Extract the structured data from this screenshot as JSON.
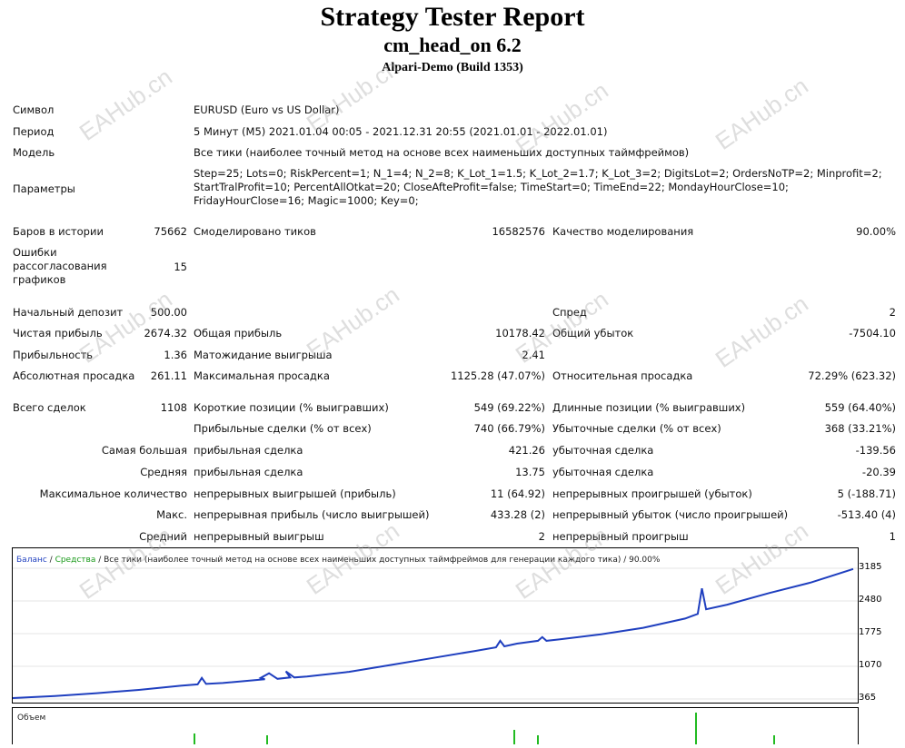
{
  "header": {
    "title": "Strategy Tester Report",
    "expert": "cm_head_on 6.2",
    "server": "Alpari-Demo (Build 1353)"
  },
  "info": {
    "symbol_label": "Символ",
    "symbol_value": "EURUSD (Euro vs US Dollar)",
    "period_label": "Период",
    "period_value": "5 Минут (M5) 2021.01.04 00:05 - 2021.12.31 20:55 (2021.01.01 - 2022.01.01)",
    "model_label": "Модель",
    "model_value": "Все тики (наиболее точный метод на основе всех наименьших доступных таймфреймов)",
    "params_label": "Параметры",
    "params_value": "Step=25; Lots=0; RiskPercent=1; N_1=4; N_2=8; K_Lot_1=1.5; K_Lot_2=1.7; K_Lot_3=2; DigitsLot=2; OrdersNoTP=2; Minprofit=2; StartTralProfit=10; PercentAllOtkat=20; CloseAfteProfit=false; TimeStart=0; TimeEnd=22; MondayHourClose=10; FridayHourClose=16; Magic=1000; Key=0;"
  },
  "stats": {
    "bars_label": "Баров в истории",
    "bars_value": "75662",
    "ticks_label": "Смоделировано тиков",
    "ticks_value": "16582576",
    "quality_label": "Качество моделирования",
    "quality_value": "90.00%",
    "mismatch_label": "Ошибки рассогласования графиков",
    "mismatch_value": "15",
    "deposit_label": "Начальный депозит",
    "deposit_value": "500.00",
    "spread_label": "Спред",
    "spread_value": "2",
    "net_label": "Чистая прибыль",
    "net_value": "2674.32",
    "gross_profit_label": "Общая прибыль",
    "gross_profit_value": "10178.42",
    "gross_loss_label": "Общий убыток",
    "gross_loss_value": "-7504.10",
    "pf_label": "Прибыльность",
    "pf_value": "1.36",
    "payoff_label": "Матожидание выигрыша",
    "payoff_value": "2.41",
    "abs_dd_label": "Абсолютная просадка",
    "abs_dd_value": "261.11",
    "max_dd_label": "Максимальная просадка",
    "max_dd_value": "1125.28 (47.07%)",
    "rel_dd_label": "Относительная просадка",
    "rel_dd_value": "72.29% (623.32)",
    "trades_label": "Всего сделок",
    "trades_value": "1108",
    "short_label": "Короткие позиции (% выигравших)",
    "short_value": "549 (69.22%)",
    "long_label": "Длинные позиции (% выигравших)",
    "long_value": "559 (64.40%)",
    "profit_trades_label": "Прибыльные сделки (% от всех)",
    "profit_trades_value": "740 (66.79%)",
    "loss_trades_label": "Убыточные сделки (% от всех)",
    "loss_trades_value": "368 (33.21%)",
    "largest_label": "Самая большая",
    "largest_profit_label": "прибыльная сделка",
    "largest_profit_value": "421.26",
    "largest_loss_label": "убыточная сделка",
    "largest_loss_value": "-139.56",
    "average_label": "Средняя",
    "average_profit_label": "прибыльная сделка",
    "average_profit_value": "13.75",
    "average_loss_label": "убыточная сделка",
    "average_loss_value": "-20.39",
    "maxcount_label": "Максимальное количество",
    "maxcount_wins_label": "непрерывных выигрышей (прибыль)",
    "maxcount_wins_value": "11 (64.92)",
    "maxcount_losses_label": "непрерывных проигрышей (убыток)",
    "maxcount_losses_value": "5 (-188.71)",
    "maxprofit_label": "Макс.",
    "maxprofit_wins_label": "непрерывная прибыль (число выигрышей)",
    "maxprofit_wins_value": "433.28 (2)",
    "maxprofit_losses_label": "непрерывный убыток (число проигрышей)",
    "maxprofit_losses_value": "-513.40 (4)",
    "avgcons_label": "Средний",
    "avgcons_wins_label": "непрерывный выигрыш",
    "avgcons_wins_value": "2",
    "avgcons_losses_label": "непрерывный проигрыш",
    "avgcons_losses_value": "1"
  },
  "chart_legend": {
    "balance": "Баланс",
    "sep": " / ",
    "equity": "Средства",
    "rest": " / Все тики (наиболее точный метод на основе всех наименьших доступных таймфреймов для генерации каждого тика) / 90.00%"
  },
  "volume_label": "Объем",
  "watermark": "EAHub.cn",
  "colors": {
    "balance": "#1f3fbf",
    "equity": "#1a9a1a",
    "volume": "#22bb22"
  },
  "chart_data": {
    "type": "line",
    "title": "",
    "xlabel": "",
    "ylabel": "",
    "yticks": [
      "3185",
      "2480",
      "1775",
      "1070",
      "365"
    ],
    "ylim": [
      365,
      3185
    ],
    "series": [
      {
        "name": "Баланс",
        "x": [
          0,
          5,
          10,
          15,
          20,
          22,
          22.5,
          23,
          25,
          30,
          29.5,
          30.5,
          31.5,
          33,
          32.5,
          33.5,
          35,
          40,
          45,
          50,
          55,
          57.5,
          58,
          58.5,
          60,
          62.5,
          63,
          63.5,
          65,
          70,
          75,
          80,
          81.5,
          82,
          82.5,
          85,
          90,
          95,
          100
        ],
        "y": [
          385,
          430,
          490,
          560,
          650,
          680,
          820,
          690,
          710,
          790,
          820,
          920,
          800,
          830,
          960,
          830,
          850,
          950,
          1100,
          1250,
          1400,
          1480,
          1620,
          1500,
          1560,
          1620,
          1700,
          1620,
          1650,
          1760,
          1900,
          2100,
          2200,
          2750,
          2300,
          2400,
          2650,
          2880,
          3170
        ]
      }
    ]
  }
}
